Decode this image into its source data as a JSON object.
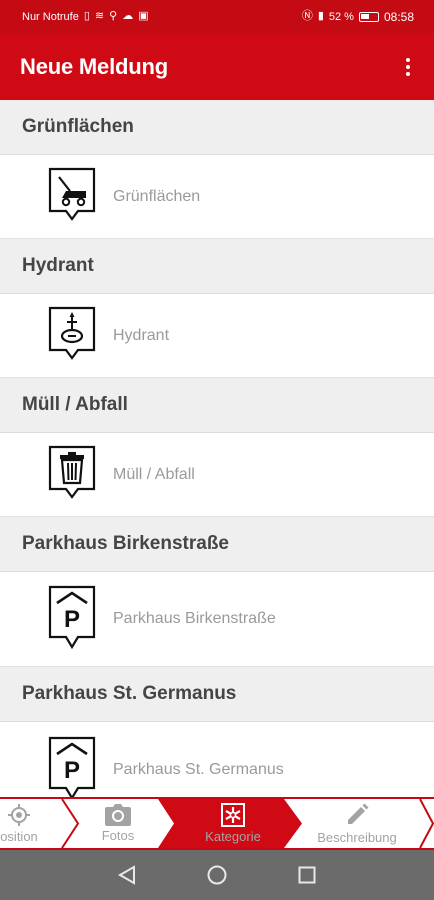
{
  "status_bar": {
    "carrier": "Nur Notrufe",
    "battery": "52 %",
    "time": "08:58"
  },
  "app_bar": {
    "title": "Neue Meldung",
    "menu_icon": "overflow-menu-icon"
  },
  "categories": [
    {
      "header": "Grünflächen",
      "label": "Grünflächen",
      "icon": "lawnmower-icon"
    },
    {
      "header": "Hydrant",
      "label": "Hydrant",
      "icon": "hydrant-icon"
    },
    {
      "header": "Müll / Abfall",
      "label": "Müll / Abfall",
      "icon": "trash-icon"
    },
    {
      "header": "Parkhaus Birkenstraße",
      "label": "Parkhaus Birkenstraße",
      "icon": "parking-garage-icon"
    },
    {
      "header": "Parkhaus St. Germanus",
      "label": "Parkhaus St. Germanus",
      "icon": "parking-garage-icon"
    }
  ],
  "tabs": [
    {
      "label": "osition",
      "icon": "location-icon",
      "active": false
    },
    {
      "label": "Fotos",
      "icon": "camera-icon",
      "active": false
    },
    {
      "label": "Kategorie",
      "icon": "category-icon",
      "active": true
    },
    {
      "label": "Beschreibung",
      "icon": "pencil-icon",
      "active": false
    }
  ],
  "colors": {
    "brand_red": "#cf0a14",
    "header_bg": "#efefef",
    "inactive_tab_text": "#a3a3a3"
  }
}
